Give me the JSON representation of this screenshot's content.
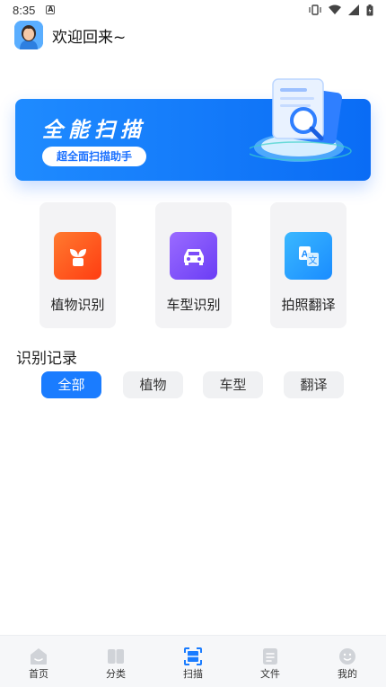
{
  "status_bar": {
    "time": "8:35",
    "notification_letter": "A"
  },
  "header": {
    "greeting": "欢迎回来~"
  },
  "banner": {
    "title": "全能扫描",
    "subtitle_button": "超全面扫描助手",
    "accent_color": "#1a7cff"
  },
  "features": [
    {
      "label": "植物识别",
      "icon": "plant-icon",
      "color": "#ff5a1f"
    },
    {
      "label": "车型识别",
      "icon": "car-icon",
      "color": "#8a5bff"
    },
    {
      "label": "拍照翻译",
      "icon": "translate-icon",
      "color": "#1fa4ff"
    }
  ],
  "records": {
    "title": "识别记录",
    "filters": [
      "全部",
      "植物",
      "车型",
      "翻译"
    ],
    "selected_filter": "全部"
  },
  "bottom_nav": {
    "items": [
      {
        "label": "首页",
        "icon": "home-icon"
      },
      {
        "label": "分类",
        "icon": "category-icon"
      },
      {
        "label": "扫描",
        "icon": "scan-icon"
      },
      {
        "label": "文件",
        "icon": "file-icon"
      },
      {
        "label": "我的",
        "icon": "profile-icon"
      }
    ],
    "selected": "扫描"
  }
}
